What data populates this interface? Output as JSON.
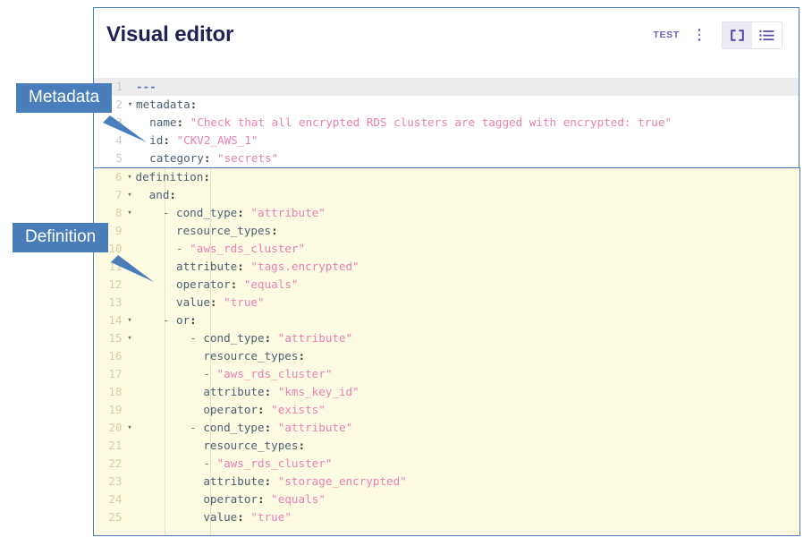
{
  "header": {
    "title": "Visual editor",
    "test_badge": "TEST",
    "kebab_icon": "vertical-dots-icon",
    "toggle": {
      "code_view": {
        "icon": "code-brackets-icon",
        "label": "[ ]",
        "active": true
      },
      "list_view": {
        "icon": "list-view-icon",
        "label": "list",
        "active": false
      }
    }
  },
  "callouts": [
    {
      "label": "Metadata"
    },
    {
      "label": "Definition"
    }
  ],
  "editor": {
    "language": "yaml",
    "metadata_lines": [
      {
        "num": "1",
        "fold": "",
        "highlight": true,
        "tokens": [
          {
            "t": "doc",
            "v": "---"
          }
        ]
      },
      {
        "num": "2",
        "fold": "▾",
        "highlight": false,
        "tokens": [
          {
            "t": "key",
            "v": "metadata"
          },
          {
            "t": "punct",
            "v": ":"
          }
        ]
      },
      {
        "num": "3",
        "fold": "",
        "highlight": false,
        "tokens": [
          {
            "t": "key",
            "v": "  name"
          },
          {
            "t": "punct",
            "v": ":"
          },
          {
            "t": "str",
            "v": " \"Check that all encrypted RDS clusters are tagged with encrypted: true\""
          }
        ]
      },
      {
        "num": "4",
        "fold": "",
        "highlight": false,
        "tokens": [
          {
            "t": "key",
            "v": "  id"
          },
          {
            "t": "punct",
            "v": ":"
          },
          {
            "t": "str",
            "v": " \"CKV2_AWS_1\""
          }
        ]
      },
      {
        "num": "5",
        "fold": "",
        "highlight": false,
        "tokens": [
          {
            "t": "key",
            "v": "  category"
          },
          {
            "t": "punct",
            "v": ":"
          },
          {
            "t": "str",
            "v": " \"secrets\""
          }
        ]
      }
    ],
    "definition_lines": [
      {
        "num": "6",
        "fold": "▾",
        "tokens": [
          {
            "t": "key",
            "v": "definition"
          },
          {
            "t": "punct",
            "v": ":"
          }
        ]
      },
      {
        "num": "7",
        "fold": "▾",
        "tokens": [
          {
            "t": "key",
            "v": "  and"
          },
          {
            "t": "punct",
            "v": ":"
          }
        ]
      },
      {
        "num": "8",
        "fold": "▾",
        "tokens": [
          {
            "t": "dash",
            "v": "    - "
          },
          {
            "t": "key",
            "v": "cond_type"
          },
          {
            "t": "punct",
            "v": ":"
          },
          {
            "t": "str",
            "v": " \"attribute\""
          }
        ]
      },
      {
        "num": "9",
        "fold": "",
        "tokens": [
          {
            "t": "key",
            "v": "      resource_types"
          },
          {
            "t": "punct",
            "v": ":"
          }
        ]
      },
      {
        "num": "10",
        "fold": "",
        "tokens": [
          {
            "t": "dash",
            "v": "      - "
          },
          {
            "t": "str",
            "v": "\"aws_rds_cluster\""
          }
        ]
      },
      {
        "num": "11",
        "fold": "",
        "tokens": [
          {
            "t": "key",
            "v": "      attribute"
          },
          {
            "t": "punct",
            "v": ":"
          },
          {
            "t": "str",
            "v": " \"tags.encrypted\""
          }
        ]
      },
      {
        "num": "12",
        "fold": "",
        "tokens": [
          {
            "t": "key",
            "v": "      operator"
          },
          {
            "t": "punct",
            "v": ":"
          },
          {
            "t": "str",
            "v": " \"equals\""
          }
        ]
      },
      {
        "num": "13",
        "fold": "",
        "tokens": [
          {
            "t": "key",
            "v": "      value"
          },
          {
            "t": "punct",
            "v": ":"
          },
          {
            "t": "str",
            "v": " \"true\""
          }
        ]
      },
      {
        "num": "14",
        "fold": "▾",
        "tokens": [
          {
            "t": "dash",
            "v": "    - "
          },
          {
            "t": "key",
            "v": "or"
          },
          {
            "t": "punct",
            "v": ":"
          }
        ]
      },
      {
        "num": "15",
        "fold": "▾",
        "tokens": [
          {
            "t": "dash",
            "v": "        - "
          },
          {
            "t": "key",
            "v": "cond_type"
          },
          {
            "t": "punct",
            "v": ":"
          },
          {
            "t": "str",
            "v": " \"attribute\""
          }
        ]
      },
      {
        "num": "16",
        "fold": "",
        "tokens": [
          {
            "t": "key",
            "v": "          resource_types"
          },
          {
            "t": "punct",
            "v": ":"
          }
        ]
      },
      {
        "num": "17",
        "fold": "",
        "tokens": [
          {
            "t": "dash",
            "v": "          - "
          },
          {
            "t": "str",
            "v": "\"aws_rds_cluster\""
          }
        ]
      },
      {
        "num": "18",
        "fold": "",
        "tokens": [
          {
            "t": "key",
            "v": "          attribute"
          },
          {
            "t": "punct",
            "v": ":"
          },
          {
            "t": "str",
            "v": " \"kms_key_id\""
          }
        ]
      },
      {
        "num": "19",
        "fold": "",
        "tokens": [
          {
            "t": "key",
            "v": "          operator"
          },
          {
            "t": "punct",
            "v": ":"
          },
          {
            "t": "str",
            "v": " \"exists\""
          }
        ]
      },
      {
        "num": "20",
        "fold": "▾",
        "tokens": [
          {
            "t": "dash",
            "v": "        - "
          },
          {
            "t": "key",
            "v": "cond_type"
          },
          {
            "t": "punct",
            "v": ":"
          },
          {
            "t": "str",
            "v": " \"attribute\""
          }
        ]
      },
      {
        "num": "21",
        "fold": "",
        "tokens": [
          {
            "t": "key",
            "v": "          resource_types"
          },
          {
            "t": "punct",
            "v": ":"
          }
        ]
      },
      {
        "num": "22",
        "fold": "",
        "tokens": [
          {
            "t": "dash",
            "v": "          - "
          },
          {
            "t": "str",
            "v": "\"aws_rds_cluster\""
          }
        ]
      },
      {
        "num": "23",
        "fold": "",
        "tokens": [
          {
            "t": "key",
            "v": "          attribute"
          },
          {
            "t": "punct",
            "v": ":"
          },
          {
            "t": "str",
            "v": " \"storage_encrypted\""
          }
        ]
      },
      {
        "num": "24",
        "fold": "",
        "tokens": [
          {
            "t": "key",
            "v": "          operator"
          },
          {
            "t": "punct",
            "v": ":"
          },
          {
            "t": "str",
            "v": " \"equals\""
          }
        ]
      },
      {
        "num": "25",
        "fold": "",
        "tokens": [
          {
            "t": "key",
            "v": "          value"
          },
          {
            "t": "punct",
            "v": ":"
          },
          {
            "t": "str",
            "v": " \"true\""
          }
        ]
      }
    ]
  },
  "colors": {
    "accent_blue": "#4a7ebb",
    "definition_bg": "#fdfce3",
    "title": "#1f2252",
    "badge_purple": "#6f5fc0",
    "string": "#e87fb3",
    "key": "#4d6075",
    "line_number": "#d6cfa8"
  }
}
